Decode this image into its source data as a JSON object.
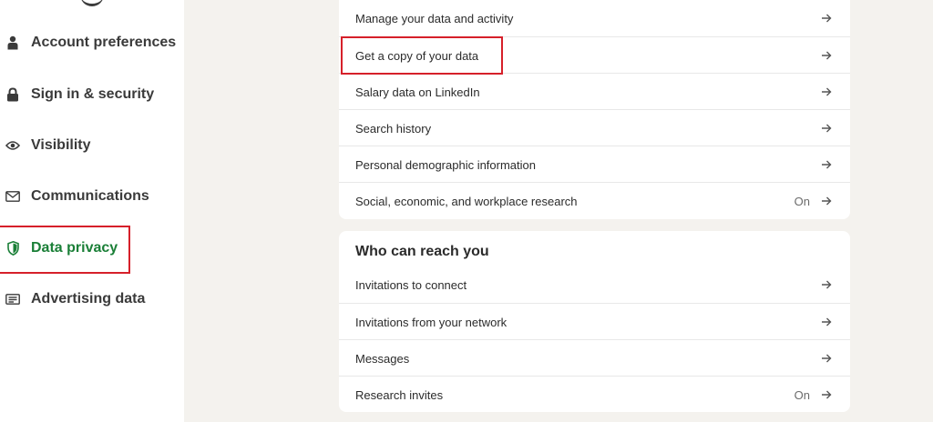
{
  "sidebar": {
    "items": [
      {
        "label": "Account preferences",
        "icon": "person-icon"
      },
      {
        "label": "Sign in & security",
        "icon": "lock-icon"
      },
      {
        "label": "Visibility",
        "icon": "eye-icon"
      },
      {
        "label": "Communications",
        "icon": "envelope-icon"
      },
      {
        "label": "Data privacy",
        "icon": "shield-icon",
        "active": true
      },
      {
        "label": "Advertising data",
        "icon": "ad-card-icon"
      }
    ]
  },
  "data_privacy_card": {
    "rows": [
      {
        "label": "Manage your data and activity",
        "status": ""
      },
      {
        "label": "Get a copy of your data",
        "status": ""
      },
      {
        "label": "Salary data on LinkedIn",
        "status": ""
      },
      {
        "label": "Search history",
        "status": ""
      },
      {
        "label": "Personal demographic information",
        "status": ""
      },
      {
        "label": "Social, economic, and workplace research",
        "status": "On"
      }
    ]
  },
  "reach_card": {
    "title": "Who can reach you",
    "rows": [
      {
        "label": "Invitations to connect",
        "status": ""
      },
      {
        "label": "Invitations from your network",
        "status": ""
      },
      {
        "label": "Messages",
        "status": ""
      },
      {
        "label": "Research invites",
        "status": "On"
      }
    ]
  },
  "colors": {
    "accent_green": "#1a7f37",
    "highlight_red": "#d6202a",
    "page_bg": "#f4f2ee"
  }
}
